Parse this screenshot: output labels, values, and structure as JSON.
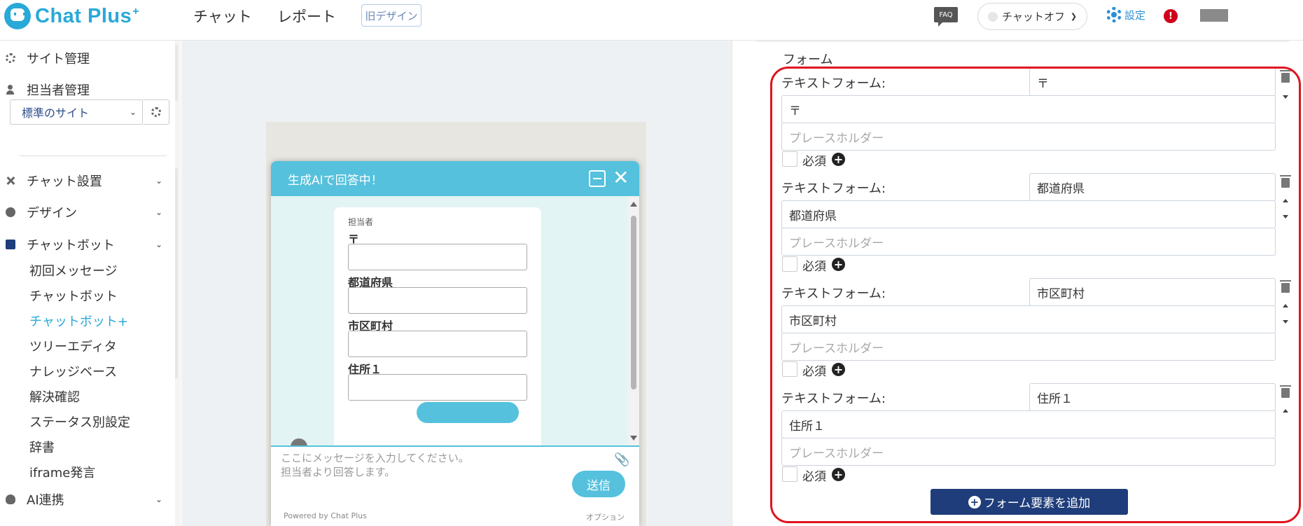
{
  "header": {
    "logo": "Chat Plus",
    "logo_sup": "+",
    "nav": [
      "チャット",
      "レポート"
    ],
    "old_design": "旧デザイン",
    "faq": "FAQ",
    "chat_toggle": "チャットオフ",
    "settings": "設定",
    "alert": "!"
  },
  "sidebar": {
    "site_management": "サイト管理",
    "staff_management": "担当者管理",
    "site_select": "標準のサイト",
    "sections": {
      "chat_setup": "チャット設置",
      "design": "デザイン",
      "chatbot": "チャットボット",
      "ai": "AI連携"
    },
    "chatbot_items": [
      "初回メッセージ",
      "チャットボット",
      "チャットボット+",
      "ツリーエディタ",
      "ナレッジベース",
      "解決確認",
      "ステータス別設定",
      "辞書",
      "iframe発言"
    ],
    "active_item": "チャットボット+"
  },
  "widget": {
    "title": "生成AIで回答中！",
    "staff_label": "担当者",
    "fields": [
      "〒",
      "都道府県",
      "市区町村",
      "住所１"
    ],
    "placeholder_line1": "ここにメッセージを入力してください。",
    "placeholder_line2": "担当者より回答します。",
    "send": "送信",
    "powered_by": "Powered by Chat Plus",
    "options": "オプション"
  },
  "form": {
    "title": "フォーム",
    "elements": [
      {
        "label": "テキストフォーム:",
        "name": "〒",
        "value": "〒",
        "placeholder": "プレースホルダー",
        "required_label": "必須"
      },
      {
        "label": "テキストフォーム:",
        "name": "都道府県",
        "value": "都道府県",
        "placeholder": "プレースホルダー",
        "required_label": "必須"
      },
      {
        "label": "テキストフォーム:",
        "name": "市区町村",
        "value": "市区町村",
        "placeholder": "プレースホルダー",
        "required_label": "必須"
      },
      {
        "label": "テキストフォーム:",
        "name": "住所１",
        "value": "住所１",
        "placeholder": "プレースホルダー",
        "required_label": "必須"
      }
    ],
    "add_button": "フォーム要素を追加"
  },
  "colors": {
    "brand": "#29a9d8",
    "widget_header": "#55c1dc",
    "primary_button": "#1f3d7a",
    "highlight": "#e0141e",
    "settings_link": "#2d8fd5",
    "alert": "#d0021b"
  }
}
